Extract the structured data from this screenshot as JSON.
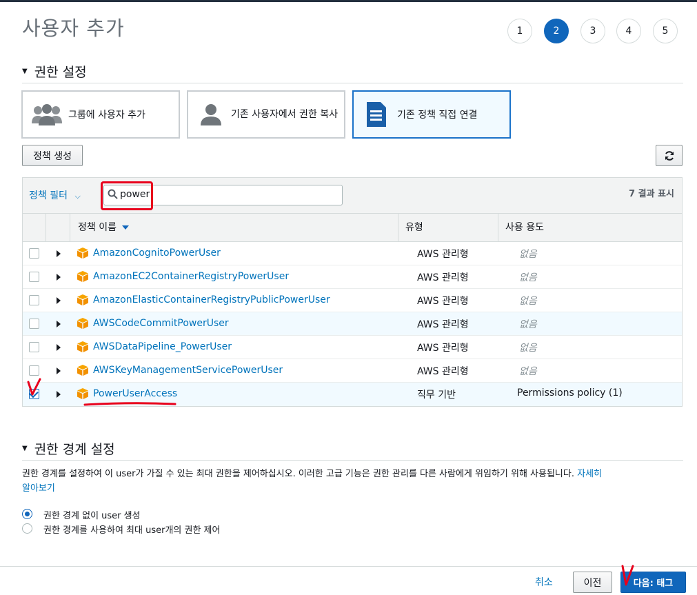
{
  "page": {
    "title": "사용자 추가"
  },
  "steps": [
    "1",
    "2",
    "3",
    "4",
    "5"
  ],
  "active_step": "2",
  "permissions": {
    "heading": "권한 설정",
    "options": [
      {
        "label": "그룹에 사용자 추가",
        "icon": "group-icon"
      },
      {
        "label": "기존 사용자에서 권한 복사",
        "icon": "user-icon"
      },
      {
        "label": "기존 정책 직접 연결",
        "icon": "document-icon",
        "selected": true
      }
    ]
  },
  "toolbar": {
    "create_policy_label": "정책 생성",
    "refresh_icon": "refresh-icon"
  },
  "filter": {
    "label": "정책 필터",
    "search_value": "power",
    "result_count": "7 결과 표시"
  },
  "table": {
    "headers": {
      "name": "정책 이름",
      "type": "유형",
      "usage": "사용 용도"
    },
    "rows": [
      {
        "name": "AmazonCognitoPowerUser",
        "type": "AWS 관리형",
        "usage": "없음",
        "checked": false
      },
      {
        "name": "AmazonEC2ContainerRegistryPowerUser",
        "type": "AWS 관리형",
        "usage": "없음",
        "checked": false
      },
      {
        "name": "AmazonElasticContainerRegistryPublicPowerUser",
        "type": "AWS 관리형",
        "usage": "없음",
        "checked": false
      },
      {
        "name": "AWSCodeCommitPowerUser",
        "type": "AWS 관리형",
        "usage": "없음",
        "checked": false
      },
      {
        "name": "AWSDataPipeline_PowerUser",
        "type": "AWS 관리형",
        "usage": "없음",
        "checked": false
      },
      {
        "name": "AWSKeyManagementServicePowerUser",
        "type": "AWS 관리형",
        "usage": "없음",
        "checked": false
      },
      {
        "name": "PowerUserAccess",
        "type": "직무 기반",
        "usage": "Permissions policy (1)",
        "checked": true
      }
    ]
  },
  "boundary": {
    "heading": "권한 경계 설정",
    "description": "권한 경계를 설정하여 이 user가 가질 수 있는 최대 권한을 제어하십시오. 이러한 고급 기능은 권한 관리를 다른 사람에게 위임하기 위해 사용됩니다.",
    "learn_more_line1": "자세히",
    "learn_more_line2": "알아보기",
    "options": [
      {
        "label": "권한 경계 없이 user 생성",
        "selected": true
      },
      {
        "label": "권한 경계를 사용하여 최대 user개의 권한 제어",
        "selected": false
      }
    ]
  },
  "footer": {
    "cancel": "취소",
    "previous": "이전",
    "next": "다음: 태그"
  },
  "colors": {
    "accent": "#1066bb",
    "link": "#0073bb",
    "annotation": "#e8001c",
    "aws_box": "#f29100"
  }
}
